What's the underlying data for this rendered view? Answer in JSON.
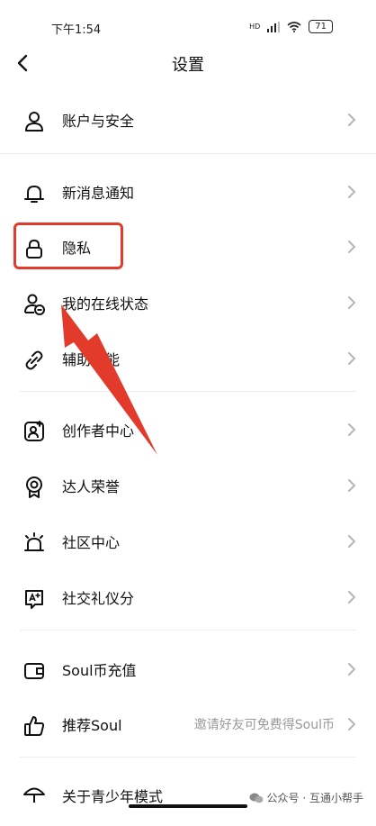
{
  "status": {
    "time": "下午1:54",
    "battery": "71",
    "network": "HD"
  },
  "header": {
    "title": "设置"
  },
  "items": [
    {
      "label": "账户与安全"
    },
    {
      "label": "新消息通知"
    },
    {
      "label": "隐私"
    },
    {
      "label": "我的在线状态"
    },
    {
      "label": "辅助功能"
    },
    {
      "label": "创作者中心"
    },
    {
      "label": "达人荣誉"
    },
    {
      "label": "社区中心"
    },
    {
      "label": "社交礼仪分"
    },
    {
      "label": "Soul币充值"
    },
    {
      "label": "推荐Soul",
      "hint": "邀请好友可免费得Soul币"
    },
    {
      "label": "关于青少年模式"
    }
  ],
  "watermark": {
    "text": "公众号 · 互通小帮手"
  },
  "colors": {
    "highlight": "#e23b2c",
    "chevron": "#b5b5b5",
    "hint": "#999999"
  }
}
